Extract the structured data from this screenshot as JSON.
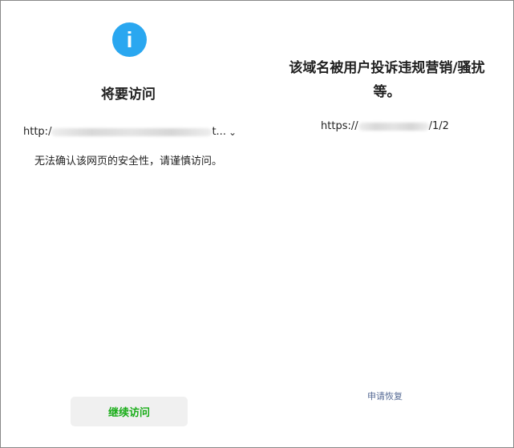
{
  "left": {
    "icon": "info-icon",
    "icon_glyph": "i",
    "title": "将要访问",
    "url_prefix": "http:/",
    "url_suffix": "t...",
    "warning": "无法确认该网页的安全性，请谨慎访问。",
    "continue_label": "继续访问",
    "accent_color": "#1aad19"
  },
  "right": {
    "title": "该域名被用户投诉违规营销/骚扰等。",
    "url_prefix": "https://",
    "url_suffix": "/1/2",
    "appeal_label": "申请恢复",
    "link_color": "#576b95"
  }
}
